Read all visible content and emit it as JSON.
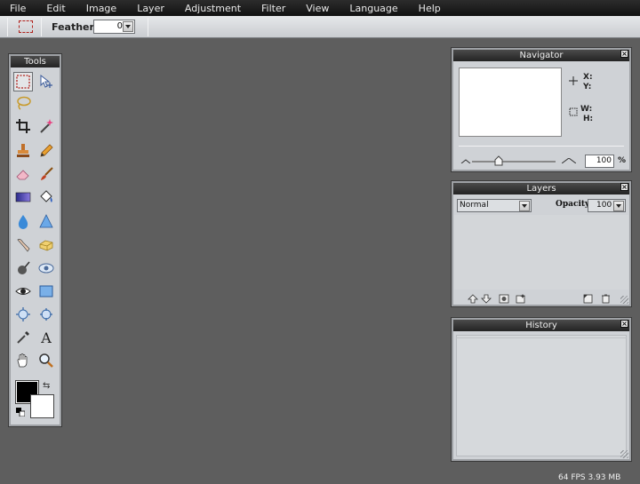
{
  "menu": [
    "File",
    "Edit",
    "Image",
    "Layer",
    "Adjustment",
    "Filter",
    "View",
    "Language",
    "Help"
  ],
  "options_bar": {
    "feather_label": "Feather:",
    "feather_value": "0"
  },
  "tools_panel": {
    "title": "Tools"
  },
  "navigator": {
    "title": "Navigator",
    "x_label": "X:",
    "y_label": "Y:",
    "w_label": "W:",
    "h_label": "H:",
    "zoom_value": "100",
    "zoom_unit": "%"
  },
  "layers": {
    "title": "Layers",
    "blend_mode": "Normal",
    "opacity_label": "Opacity:",
    "opacity_value": "100"
  },
  "history": {
    "title": "History"
  },
  "status": "64 FPS 3.93 MB",
  "colors": {
    "foreground": "#000000",
    "background": "#ffffff",
    "workspace": "#5e5e5e"
  }
}
